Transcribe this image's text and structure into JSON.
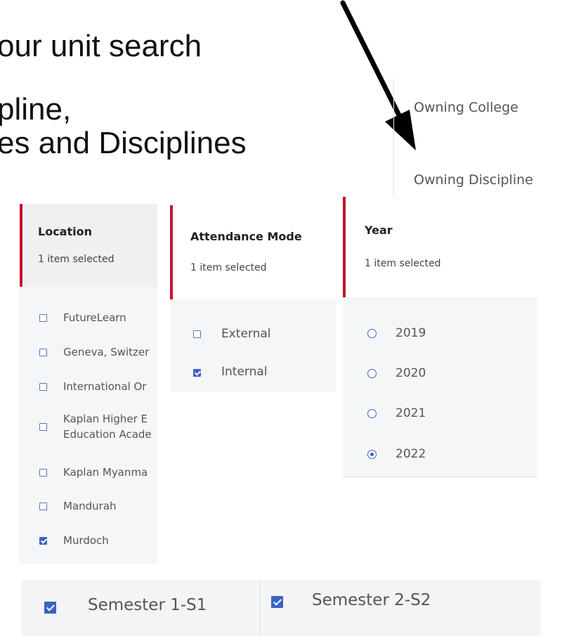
{
  "slide": {
    "line1": "our unit search",
    "line2": "pline,",
    "line3": "es and Disciplines"
  },
  "owning": {
    "items": [
      {
        "label": "Owning College"
      },
      {
        "label": "Owning Discipline"
      }
    ]
  },
  "location": {
    "title": "Location",
    "status": "1 item selected",
    "options": [
      {
        "label": "FutureLearn",
        "checked": false
      },
      {
        "label": "Geneva, Switzer",
        "checked": false
      },
      {
        "label": "International Or",
        "checked": false
      },
      {
        "label": "Kaplan Higher E",
        "label2": "Education Acade",
        "checked": false
      },
      {
        "label": "Kaplan Myanma",
        "checked": false
      },
      {
        "label": "Mandurah",
        "checked": false
      },
      {
        "label": "Murdoch",
        "checked": true
      }
    ]
  },
  "attendance": {
    "title": "Attendance Mode",
    "status": "1 item selected",
    "options": [
      {
        "label": "External",
        "checked": false
      },
      {
        "label": "Internal",
        "checked": true
      }
    ]
  },
  "year": {
    "title": "Year",
    "status": "1 item selected",
    "options": [
      {
        "label": "2019",
        "selected": false
      },
      {
        "label": "2020",
        "selected": false
      },
      {
        "label": "2021",
        "selected": false
      },
      {
        "label": "2022",
        "selected": true
      }
    ]
  },
  "semesters": [
    {
      "label": "Semester 1-S1",
      "checked": true
    },
    {
      "label": "Semester 2-S2",
      "checked": true
    }
  ],
  "colors": {
    "accent": "#c8102e",
    "checkbox": "#3b63c4"
  }
}
